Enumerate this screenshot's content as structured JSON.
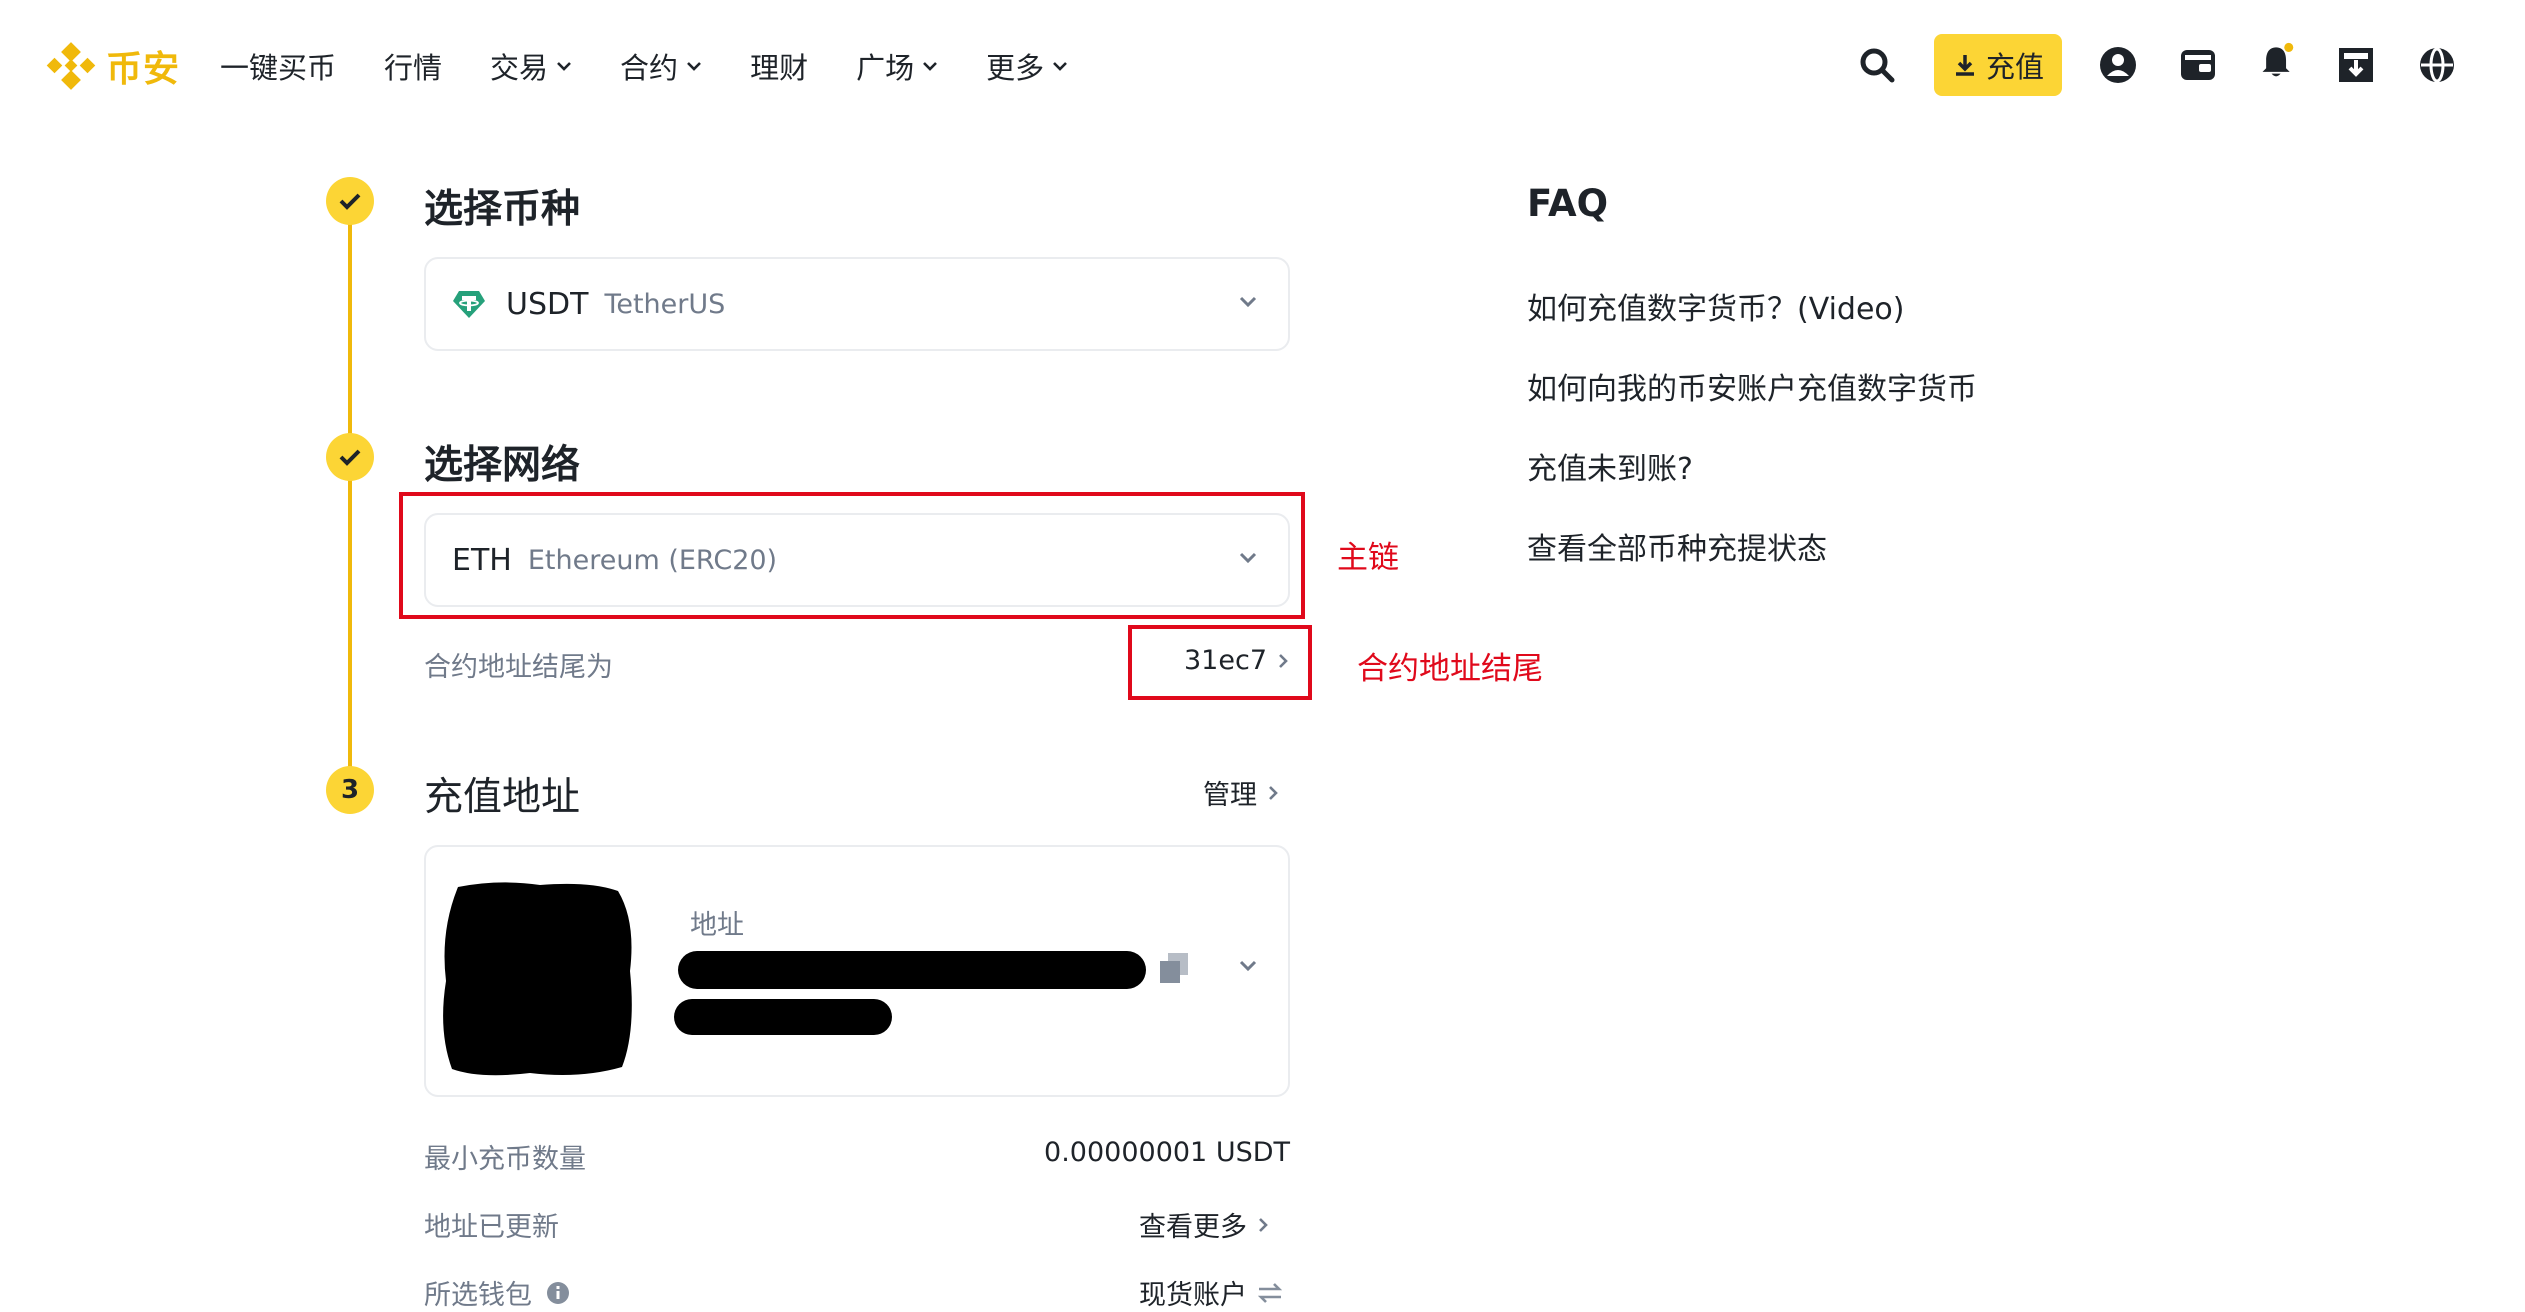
{
  "header": {
    "logo_text": "币安",
    "nav": [
      {
        "label": "一键买币",
        "dropdown": false
      },
      {
        "label": "行情",
        "dropdown": false
      },
      {
        "label": "交易",
        "dropdown": true
      },
      {
        "label": "合约",
        "dropdown": true
      },
      {
        "label": "理财",
        "dropdown": false
      },
      {
        "label": "广场",
        "dropdown": true
      },
      {
        "label": "更多",
        "dropdown": true
      }
    ],
    "deposit_label": "充值",
    "brand_color": "#f0b90b",
    "accent_color": "#fcd535"
  },
  "steps": {
    "coin": {
      "title": "选择币种",
      "symbol": "USDT",
      "name": "TetherUS"
    },
    "network": {
      "title": "选择网络",
      "symbol": "ETH",
      "name": "Ethereum (ERC20)",
      "contract_label": "合约地址结尾为",
      "contract_value": "31ec7"
    },
    "address": {
      "number": "3",
      "title": "充值地址",
      "manage_label": "管理",
      "address_label": "地址",
      "min_label": "最小充币数量",
      "min_value": "0.00000001 USDT",
      "updated_label": "地址已更新",
      "updated_link": "查看更多",
      "wallet_label": "所选钱包",
      "wallet_value": "现货账户"
    }
  },
  "annotations": {
    "main_chain": "主链",
    "contract_end": "合约地址结尾",
    "color": "#e0091b"
  },
  "faq": {
    "title": "FAQ",
    "items": [
      "如何充值数字货币？(Video)",
      "如何向我的币安账户充值数字货币",
      "充值未到账?",
      "查看全部币种充提状态"
    ]
  }
}
